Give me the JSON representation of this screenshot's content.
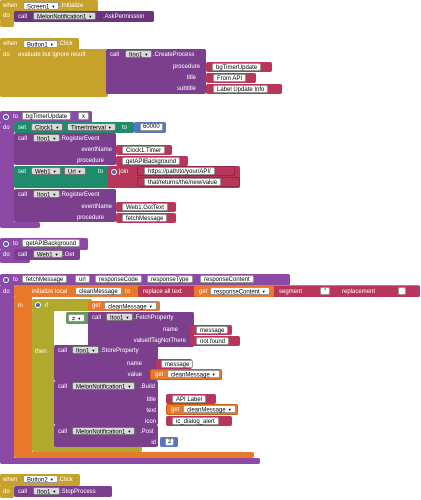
{
  "blocks": {
    "screen1_init": {
      "when": "when",
      "component": "Screen1",
      "event": ".Initialize",
      "do": "do",
      "call": "call",
      "target": "MelonNotification1",
      "method": ".AskPermission"
    },
    "button1_click": {
      "when": "when",
      "component": "Button1",
      "event": ".Click",
      "do": "do",
      "evaluate": "evaluate but ignore result",
      "call": "call",
      "target": "Itoo1",
      "method": ".CreateProcess",
      "p_procedure": "procedure",
      "v_procedure": "bgTimerUpdate",
      "p_title": "title",
      "v_title": "From API",
      "p_subtitle": "subtitle",
      "v_subtitle": "Label Update Info"
    },
    "bg_timer_update": {
      "to": "to",
      "name": "bgTimerUpdate",
      "x": "x",
      "do": "do",
      "set": "set",
      "clock": "Clock1",
      "timer_prop": "TimerInterval",
      "to2": "to",
      "interval": "60000",
      "call": "call",
      "itoo": "Itoo1",
      "register": ".RegisterEvent",
      "p_event": "eventName",
      "v_event": "Clock1.Timer",
      "p_proc": "procedure",
      "v_proc": "getAPIBackground",
      "set2": "set",
      "web": "Web1",
      "url_prop": "Url",
      "to3": "to",
      "join": "join",
      "url1": "https://path/to/your/API/",
      "url2": "that/returns/the/new/value",
      "call2": "call",
      "itoo2": "Itoo1",
      "register2": ".RegisterEvent",
      "p_event2": "eventName",
      "v_event2": "Web1.GotText",
      "p_proc2": "procedure",
      "v_proc2": "fetchMessage"
    },
    "get_api_bg": {
      "to": "to",
      "name": "getAPIBackground",
      "do": "do",
      "call": "call",
      "web": "Web1",
      "method": ".Get"
    },
    "fetch_message": {
      "to": "to",
      "name": "fetchMessage",
      "a1": "url",
      "a2": "responseCode",
      "a3": "responseType",
      "a4": "responseContent",
      "do": "do",
      "init": "initialize local",
      "var": "cleanMessage",
      "to2": "to",
      "replace": "replace all text",
      "get": "get",
      "get_var": "responseContent",
      "segment": "segment",
      "seg_val": "\"",
      "replacement": "replacement",
      "rep_val": "",
      "in": "in",
      "if": "if",
      "eq": "≠",
      "call": "call",
      "fetch_target": "Itoo1",
      "fetch_method": ".FetchProperty",
      "p_name": "name",
      "v_name": "message",
      "p_vnt": "valueIfTagNotThere",
      "v_vnt": "not found",
      "get2": "get",
      "get2_var": "cleanMessage",
      "then": "then",
      "call2": "call",
      "store_target": "Itoo1",
      "store_method": ".StoreProperty",
      "p_name2": "name",
      "v_name2": "message",
      "p_value": "value",
      "get3": "get",
      "get3_var": "cleanMessage",
      "call3": "call",
      "build_target": "MelonNotification1",
      "build_method": ".Build",
      "p_title": "title",
      "v_title": "API Label",
      "p_text": "text",
      "get4": "get",
      "get4_var": "cleanMessage",
      "p_icon": "icon",
      "v_icon": "ic_dialog_alert",
      "call4": "call",
      "post_target": "MelonNotification1",
      "post_method": ".Post",
      "p_id": "id",
      "v_id": "2"
    },
    "button2_click": {
      "when": "when",
      "component": "Button2",
      "event": ".Click",
      "do": "do",
      "call": "call",
      "target": "Itoo1",
      "method": ".StopProcess"
    }
  }
}
